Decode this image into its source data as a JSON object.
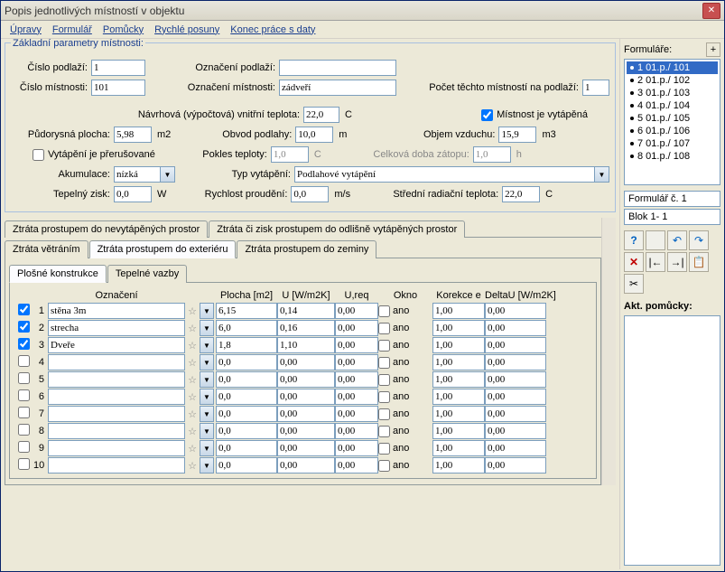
{
  "title": "Popis jednotlivých místností v objektu",
  "menu": [
    "Úpravy",
    "Formulář",
    "Pomůcky",
    "Rychlé posuny",
    "Konec práce s daty"
  ],
  "legend_basic": "Základní parametry místnosti:",
  "labels": {
    "cislo_podlazi": "Číslo podlaží:",
    "cislo_mistnosti": "Číslo místnosti:",
    "oznaceni_podlazi": "Označení podlaží:",
    "oznaceni_mistnosti": "Označení místnosti:",
    "pocet_mistnosti": "Počet těchto místností na podlaží:",
    "navrh_teplota": "Návrhová (výpočtová) vnitřní teplota:",
    "mistnost_vytapena": "Místnost je vytápěná",
    "pudorys": "Půdorysná plocha:",
    "obvod": "Obvod podlahy:",
    "objem": "Objem vzduchu:",
    "vytapeni_prerus": "Vytápění je přerušované",
    "pokles": "Pokles teploty:",
    "celk_doba": "Celková doba zátopu:",
    "akumulace": "Akumulace:",
    "typ_vytapeni": "Typ vytápění:",
    "tep_zisk": "Tepelný zisk:",
    "rychlost": "Rychlost proudění:",
    "stredni": "Střední radiační teplota:"
  },
  "values": {
    "cislo_podlazi": "1",
    "cislo_mistnosti": "101",
    "oznaceni_podlazi": "",
    "oznaceni_mistnosti": "zádveří",
    "pocet_mistnosti": "1",
    "navrh_teplota": "22,0",
    "pudorys": "5,98",
    "obvod": "10,0",
    "objem": "15,9",
    "pokles": "1,0",
    "celk_doba": "1,0",
    "akumulace": "nízká",
    "typ_vytapeni": "Podlahové vytápění",
    "tep_zisk": "0,0",
    "rychlost": "0,0",
    "stredni": "22,0"
  },
  "units": {
    "C": "C",
    "m2": "m2",
    "m": "m",
    "m3": "m3",
    "h": "h",
    "W": "W",
    "ms": "m/s"
  },
  "checkboxes": {
    "vytapena": true,
    "prerusovane": false
  },
  "tabs_upper": [
    "Ztráta prostupem do nevytápěných prostor",
    "Ztráta či zisk prostupem do odlišně vytápěných prostor"
  ],
  "tabs_lower": [
    "Ztráta větráním",
    "Ztráta prostupem do exteriéru",
    "Ztráta prostupem do zeminy"
  ],
  "subtabs": [
    "Plošné konstrukce",
    "Tepelné vazby"
  ],
  "grid_headers": {
    "oznaceni": "Označení",
    "plocha": "Plocha [m2]",
    "u": "U [W/m2K]",
    "ureq": "U,req",
    "okno": "Okno",
    "korekce": "Korekce e",
    "deltau": "DeltaU [W/m2K]",
    "ano": "ano"
  },
  "rows": [
    {
      "chk": true,
      "name": "stěna 3m",
      "plocha": "6,15",
      "u": "0,14",
      "ureq": "0,00",
      "okno": false,
      "kor": "1,00",
      "delta": "0,00"
    },
    {
      "chk": true,
      "name": "strecha",
      "plocha": "6,0",
      "u": "0,16",
      "ureq": "0,00",
      "okno": false,
      "kor": "1,00",
      "delta": "0,00"
    },
    {
      "chk": true,
      "name": "Dveře",
      "plocha": "1,8",
      "u": "1,10",
      "ureq": "0,00",
      "okno": false,
      "kor": "1,00",
      "delta": "0,00"
    },
    {
      "chk": false,
      "name": "",
      "plocha": "0,0",
      "u": "0,00",
      "ureq": "0,00",
      "okno": false,
      "kor": "1,00",
      "delta": "0,00"
    },
    {
      "chk": false,
      "name": "",
      "plocha": "0,0",
      "u": "0,00",
      "ureq": "0,00",
      "okno": false,
      "kor": "1,00",
      "delta": "0,00"
    },
    {
      "chk": false,
      "name": "",
      "plocha": "0,0",
      "u": "0,00",
      "ureq": "0,00",
      "okno": false,
      "kor": "1,00",
      "delta": "0,00"
    },
    {
      "chk": false,
      "name": "",
      "plocha": "0,0",
      "u": "0,00",
      "ureq": "0,00",
      "okno": false,
      "kor": "1,00",
      "delta": "0,00"
    },
    {
      "chk": false,
      "name": "",
      "plocha": "0,0",
      "u": "0,00",
      "ureq": "0,00",
      "okno": false,
      "kor": "1,00",
      "delta": "0,00"
    },
    {
      "chk": false,
      "name": "",
      "plocha": "0,0",
      "u": "0,00",
      "ureq": "0,00",
      "okno": false,
      "kor": "1,00",
      "delta": "0,00"
    },
    {
      "chk": false,
      "name": "",
      "plocha": "0,0",
      "u": "0,00",
      "ureq": "0,00",
      "okno": false,
      "kor": "1,00",
      "delta": "0,00"
    }
  ],
  "sidebar": {
    "title": "Formuláře:",
    "items": [
      "1 01.p./ 101",
      "2 01.p./ 102",
      "3 01.p./ 103",
      "4 01.p./ 104",
      "5 01.p./ 105",
      "6 01.p./ 106",
      "7 01.p./ 107",
      "8 01.p./ 108"
    ],
    "formular": "Formulář č. 1",
    "blok": "Blok  1- 1",
    "akt_pomucky": "Akt. pomůcky:"
  },
  "icons": {
    "help": "?",
    "undo": "↶",
    "redo": "↷",
    "delete": "✕",
    "first": "|←",
    "last": "→|",
    "paste": "📋",
    "cut": "✂"
  }
}
